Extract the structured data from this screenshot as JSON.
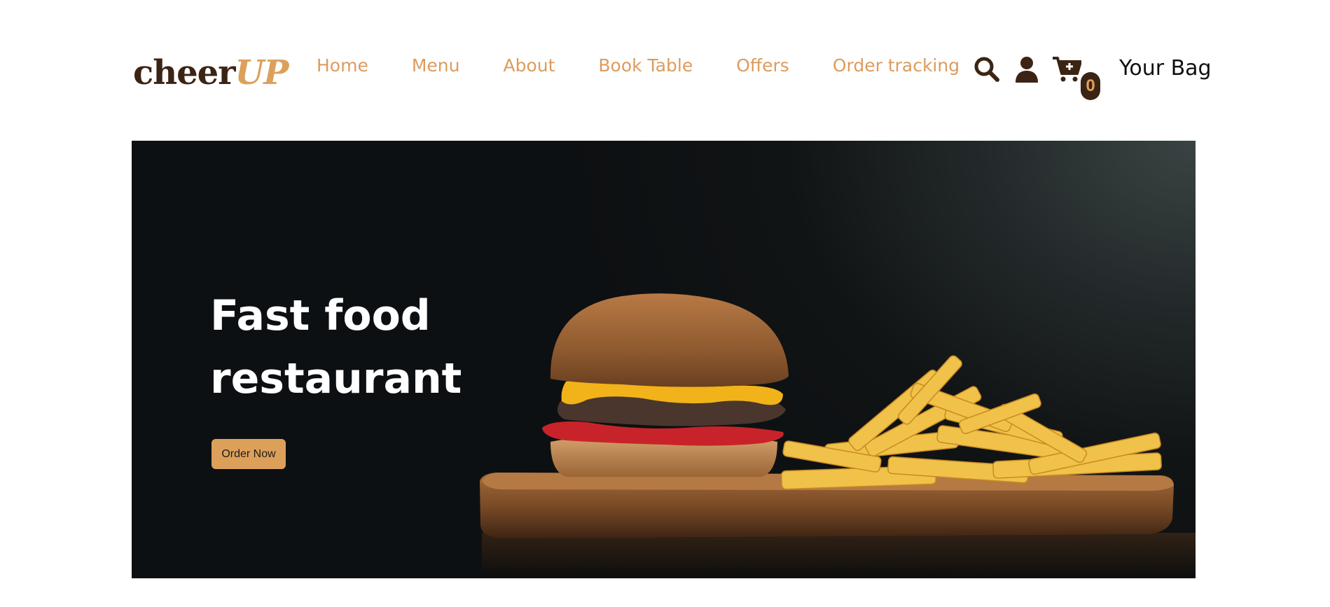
{
  "logo": {
    "part1": "cheer",
    "part2": "UP"
  },
  "nav": {
    "items": [
      {
        "label": "Home"
      },
      {
        "label": "Menu"
      },
      {
        "label": "About"
      },
      {
        "label": "Book Table"
      },
      {
        "label": "Offers"
      },
      {
        "label": "Order tracking"
      }
    ]
  },
  "header_icons": {
    "search": "search-icon",
    "user": "user-icon",
    "cart": "cart-plus-icon",
    "cart_count": "0",
    "bag_label": "Your Bag"
  },
  "hero": {
    "title_line1": "Fast food",
    "title_line2": "restaurant",
    "cta_label": "Order Now",
    "image": "burger-and-fries-photo"
  },
  "colors": {
    "accent": "#dda05a",
    "nav_text": "#dc9c5e",
    "dark_brown": "#3b2414",
    "hero_bg": "#0d1012"
  }
}
